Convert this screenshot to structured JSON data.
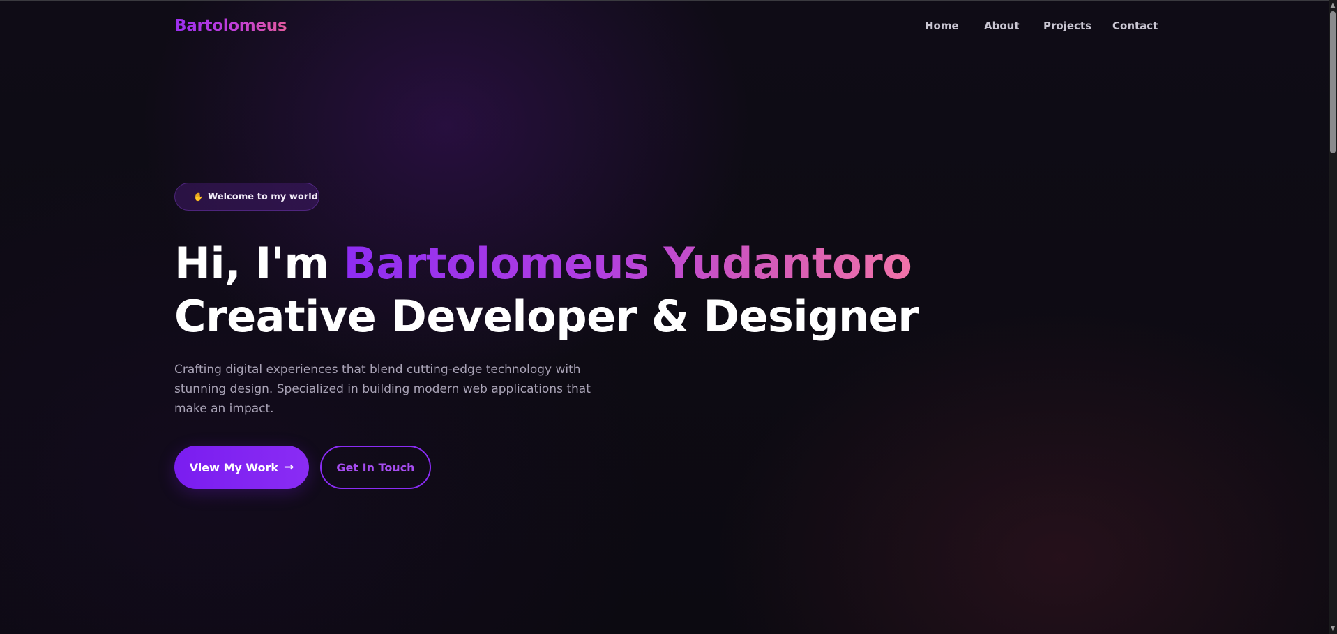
{
  "navbar": {
    "logo": "Bartolomeus",
    "links": [
      "Home",
      "About",
      "Projects",
      "Contact"
    ]
  },
  "hero": {
    "badge_icon": "waving-hand-icon",
    "badge_text": "Welcome to my world",
    "headline_prefix": "Hi, I'm ",
    "headline_name": "Bartolomeus Yudantoro",
    "headline_line2": "Creative Developer & Designer",
    "description": "Crafting digital experiences that blend cutting-edge technology with stunning design. Specialized in building modern web applications that make an impact.",
    "primary_button": "View My Work",
    "primary_button_icon": "arrow-right-icon",
    "secondary_button": "Get In Touch"
  },
  "colors": {
    "accent_purple": "#8a2cf4",
    "accent_pink": "#f173a9",
    "background": "#0c0a11"
  }
}
